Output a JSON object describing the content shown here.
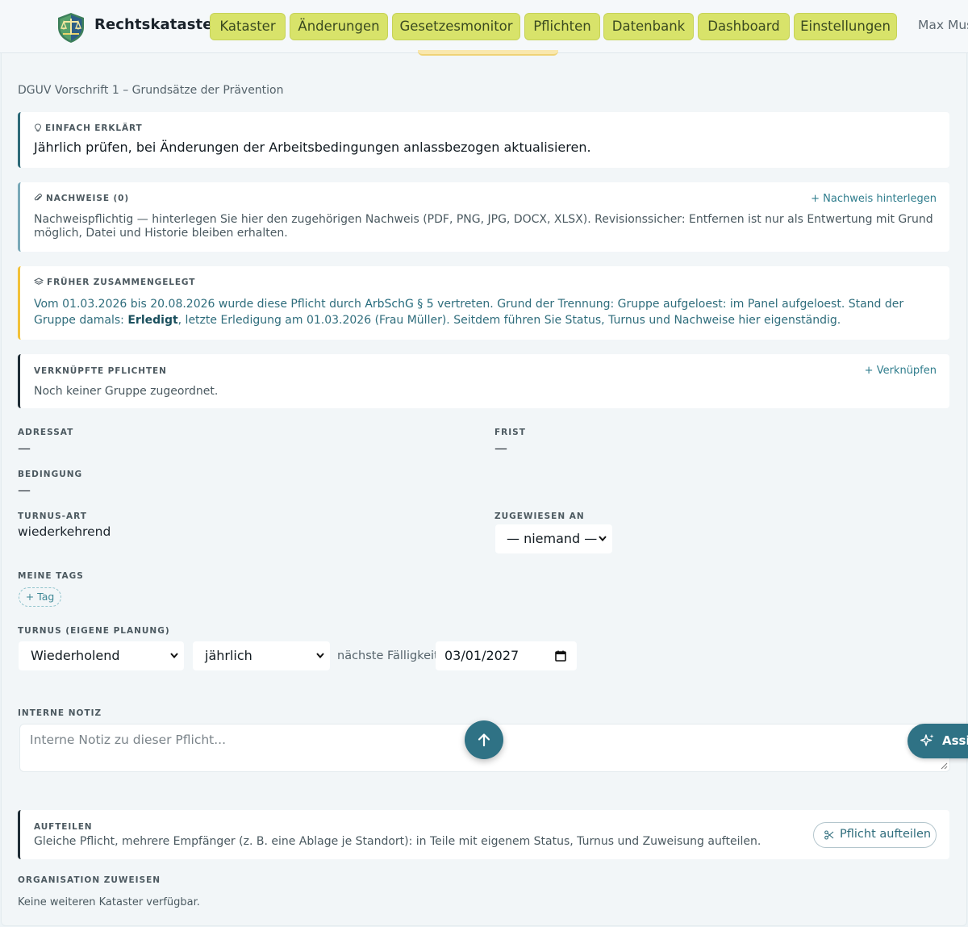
{
  "header": {
    "brand": "Rechtskataster",
    "nav": [
      {
        "label": "Kataster"
      },
      {
        "label": "Änderungen"
      },
      {
        "label": "Gesetzesmonitor"
      },
      {
        "label": "Pflichten"
      },
      {
        "label": "Datenbank"
      },
      {
        "label": "Dashboard"
      },
      {
        "label": "Einstellungen"
      }
    ],
    "user": "Max Mus"
  },
  "page": {
    "subtitle": "DGUV Vorschrift 1 – Grundsätze der Prävention"
  },
  "einfach": {
    "label": "EINFACH ERKLÄRT",
    "text": "Jährlich prüfen, bei Änderungen der Arbeitsbedingungen anlassbezogen aktualisieren."
  },
  "nachweise": {
    "label": "NACHWEISE (0)",
    "action": "+ Nachweis hinterlegen",
    "text": "Nachweispflichtig — hinterlegen Sie hier den zugehörigen Nachweis (PDF, PNG, JPG, DOCX, XLSX). Revisionssicher: Entfernen ist nur als Entwertung mit Grund möglich, Datei und Historie bleiben erhalten."
  },
  "frueher": {
    "label": "FRÜHER ZUSAMMENGELEGT",
    "part1": "Vom 01.03.2026 bis 20.08.2026 wurde diese Pflicht durch ",
    "link": "ArbSchG § 5",
    "part2": " vertreten. Grund der Trennung: Gruppe aufgeloest: im Panel aufgeloest. Stand der Gruppe damals: ",
    "status": "Erledigt",
    "part3": ", letzte Erledigung am 01.03.2026 (Frau Müller). Seitdem führen Sie Status, Turnus und Nachweise hier eigenständig."
  },
  "verknuepft": {
    "label": "VERKNÜPFTE PFLICHTEN",
    "action": "+ Verknüpfen",
    "text": "Noch keiner Gruppe zugeordnet."
  },
  "fields": {
    "adressat_label": "ADRESSAT",
    "adressat_value": "—",
    "frist_label": "FRIST",
    "frist_value": "—",
    "bedingung_label": "BEDINGUNG",
    "bedingung_value": "—",
    "turnus_art_label": "TURNUS-ART",
    "turnus_art_value": "wiederkehrend",
    "zugewiesen_label": "ZUGEWIESEN AN",
    "zugewiesen_value": "— niemand —"
  },
  "tags": {
    "label": "MEINE TAGS",
    "add": "+ Tag"
  },
  "turnus": {
    "label": "TURNUS (EIGENE PLANUNG)",
    "mode": "Wiederholend",
    "interval": "jährlich",
    "next_label": "nächste Fälligkeit",
    "next_date": "03/01/2027"
  },
  "notiz": {
    "label": "INTERNE NOTIZ",
    "placeholder": "Interne Notiz zu dieser Pflicht..."
  },
  "assist": {
    "label": "Assi"
  },
  "aufteilen": {
    "label": "AUFTEILEN",
    "text": "Gleiche Pflicht, mehrere Empfänger (z. B. eine Ablage je Standort): in Teile mit eigenem Status, Turnus und Zuweisung aufteilen.",
    "button": "Pflicht aufteilen"
  },
  "organisation": {
    "label": "ORGANISATION ZUWEISEN",
    "text": "Keine weiteren Kataster verfügbar."
  },
  "colors": {
    "nav_bg": "#d8e36a",
    "accent": "#2f7285",
    "warning_border": "#f2c23a"
  }
}
